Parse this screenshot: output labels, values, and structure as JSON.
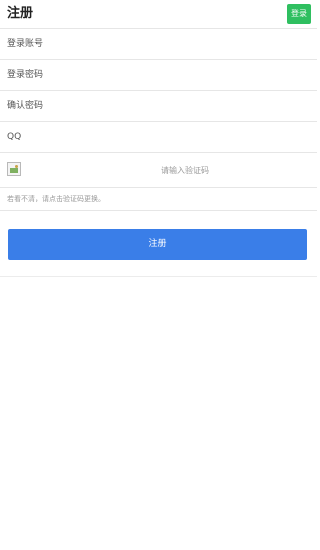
{
  "header": {
    "title": "注册",
    "login_label": "登录"
  },
  "form": {
    "account_placeholder": "登录账号",
    "password_placeholder": "登录密码",
    "confirm_placeholder": "确认密码",
    "qq_placeholder": "QQ",
    "captcha_placeholder": "请输入验证码",
    "captcha_image_icon": "broken-image-icon",
    "hint": "若看不清，请点击验证码更换。"
  },
  "submit": {
    "label": "注册"
  },
  "colors": {
    "login_button": "#2fbf60",
    "submit_button": "#3a7ee8"
  }
}
